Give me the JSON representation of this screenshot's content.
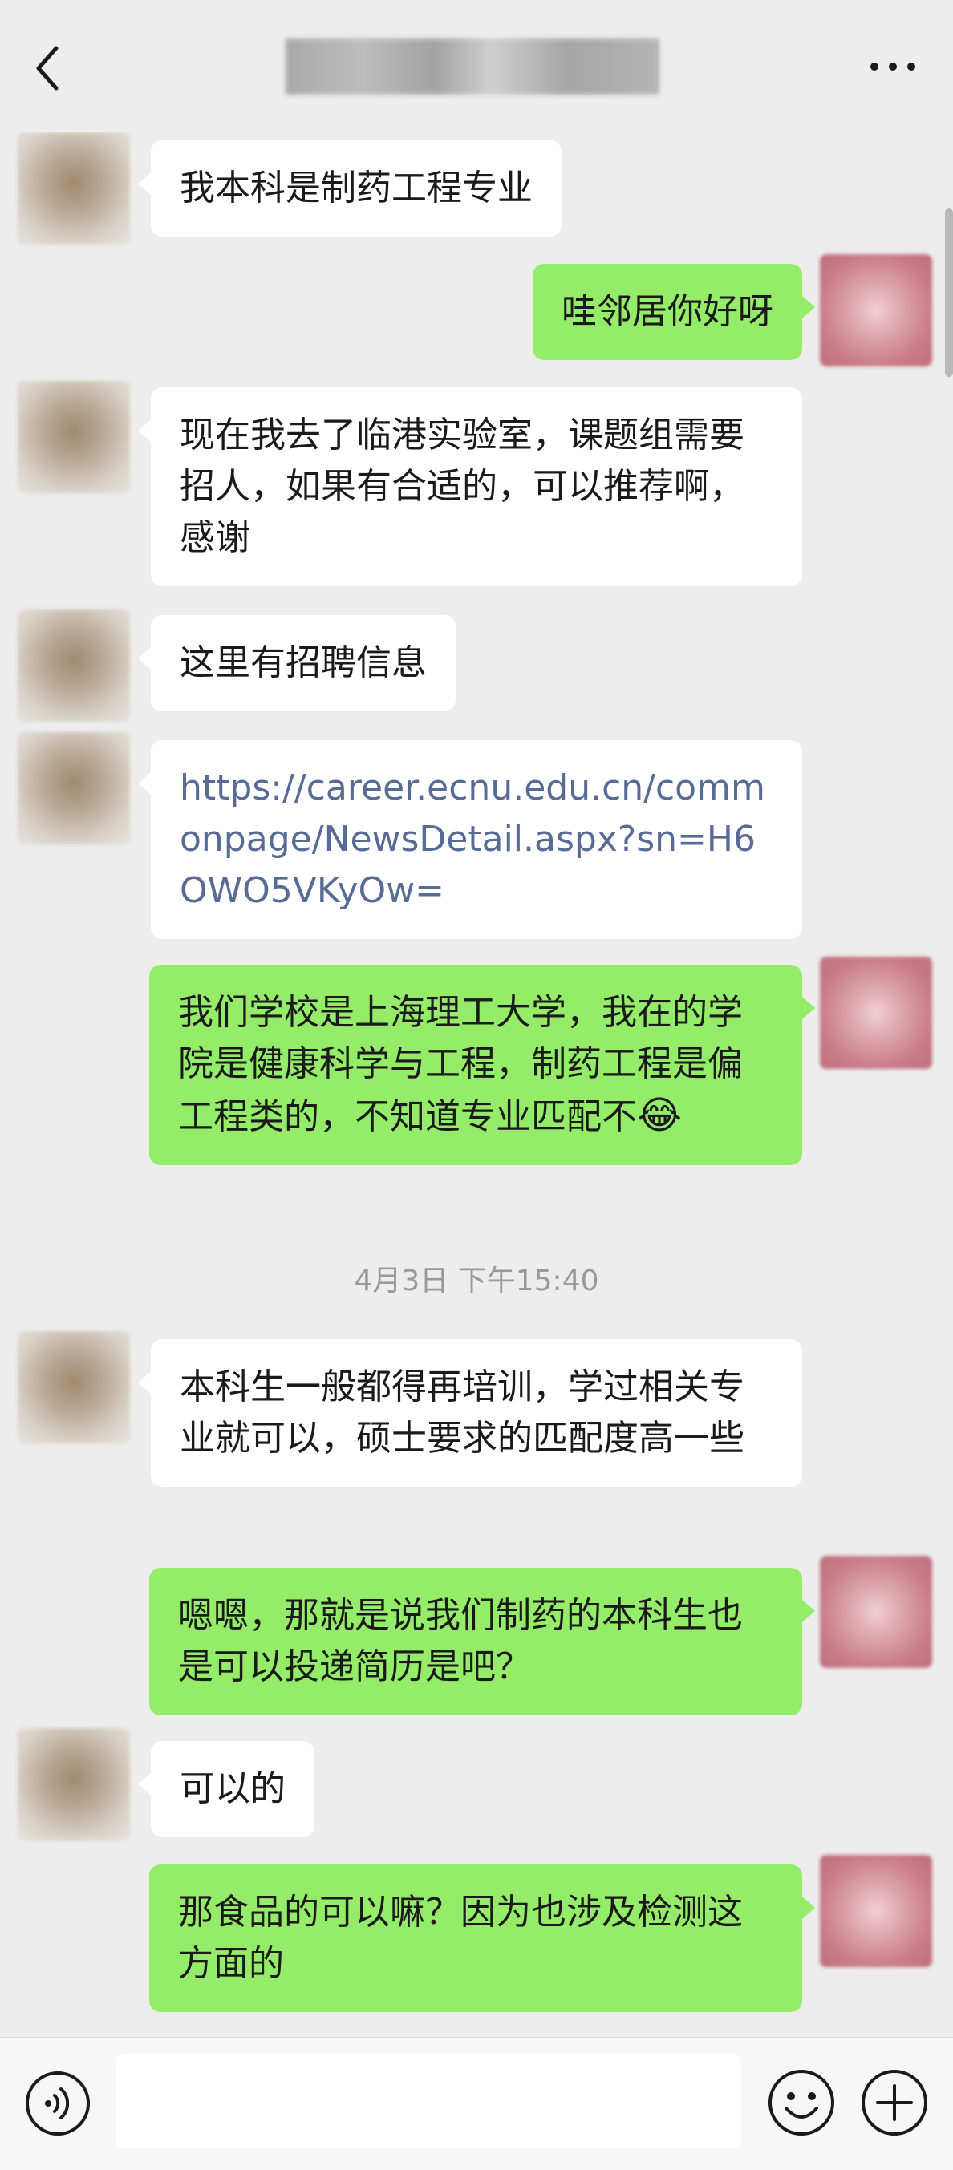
{
  "header": {
    "back_icon": "chevron-left-icon",
    "more_icon": "more-dots-icon"
  },
  "messages": [
    {
      "side": "in",
      "text": "我本科是制药工程专业"
    },
    {
      "side": "out",
      "text": "哇邻居你好呀"
    },
    {
      "side": "in",
      "text": "现在我去了临港实验室，课题组需要招人，如果有合适的，可以推荐啊，感谢"
    },
    {
      "side": "in",
      "text": "这里有招聘信息"
    },
    {
      "side": "in",
      "text": "https://career.ecnu.edu.cn/commonpage/NewsDetail.aspx?sn=H6OWO5VKyOw=",
      "is_link": true
    },
    {
      "side": "out",
      "text": "我们学校是上海理工大学，我在的学院是健康科学与工程，制药工程是偏工程类的，不知道专业匹配不",
      "emoji": "😂"
    },
    {
      "side": "in",
      "text": "本科生一般都得再培训，学过相关专业就可以，硕士要求的匹配度高一些"
    },
    {
      "side": "out",
      "text": "嗯嗯，那就是说我们制药的本科生也是可以投递简历是吧？"
    },
    {
      "side": "in",
      "text": "可以的"
    },
    {
      "side": "out",
      "text": "那食品的可以嘛？因为也涉及检测这方面的"
    }
  ],
  "timestamp": "4月3日 下午15:40",
  "input_bar": {
    "voice_icon": "voice-icon",
    "emoji_icon": "emoji-icon",
    "plus_icon": "plus-icon",
    "input_value": ""
  },
  "colors": {
    "background": "#ededed",
    "bubble_in": "#ffffff",
    "bubble_out": "#95ec69",
    "link": "#576b95"
  }
}
